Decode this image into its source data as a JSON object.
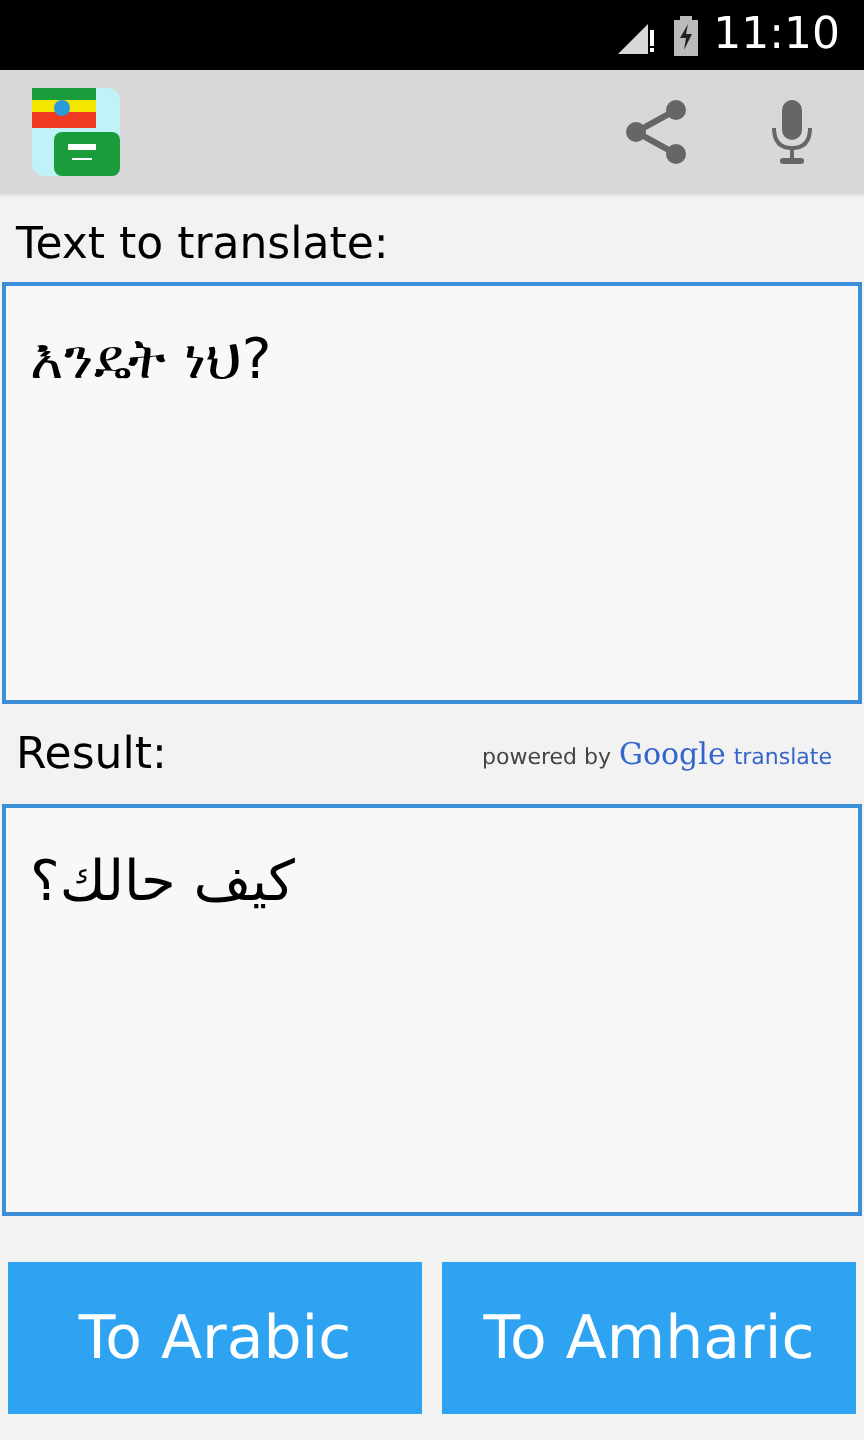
{
  "status_bar": {
    "time": "11:10"
  },
  "source": {
    "label": "Text to translate:",
    "value": "እንዴት ነህ?"
  },
  "result": {
    "label": "Result:",
    "powered_by": "powered by",
    "provider": "Google",
    "service": "translate",
    "value": "كيف حالك؟"
  },
  "buttons": [
    {
      "label": "To Arabic"
    },
    {
      "label": "To Amharic"
    }
  ]
}
